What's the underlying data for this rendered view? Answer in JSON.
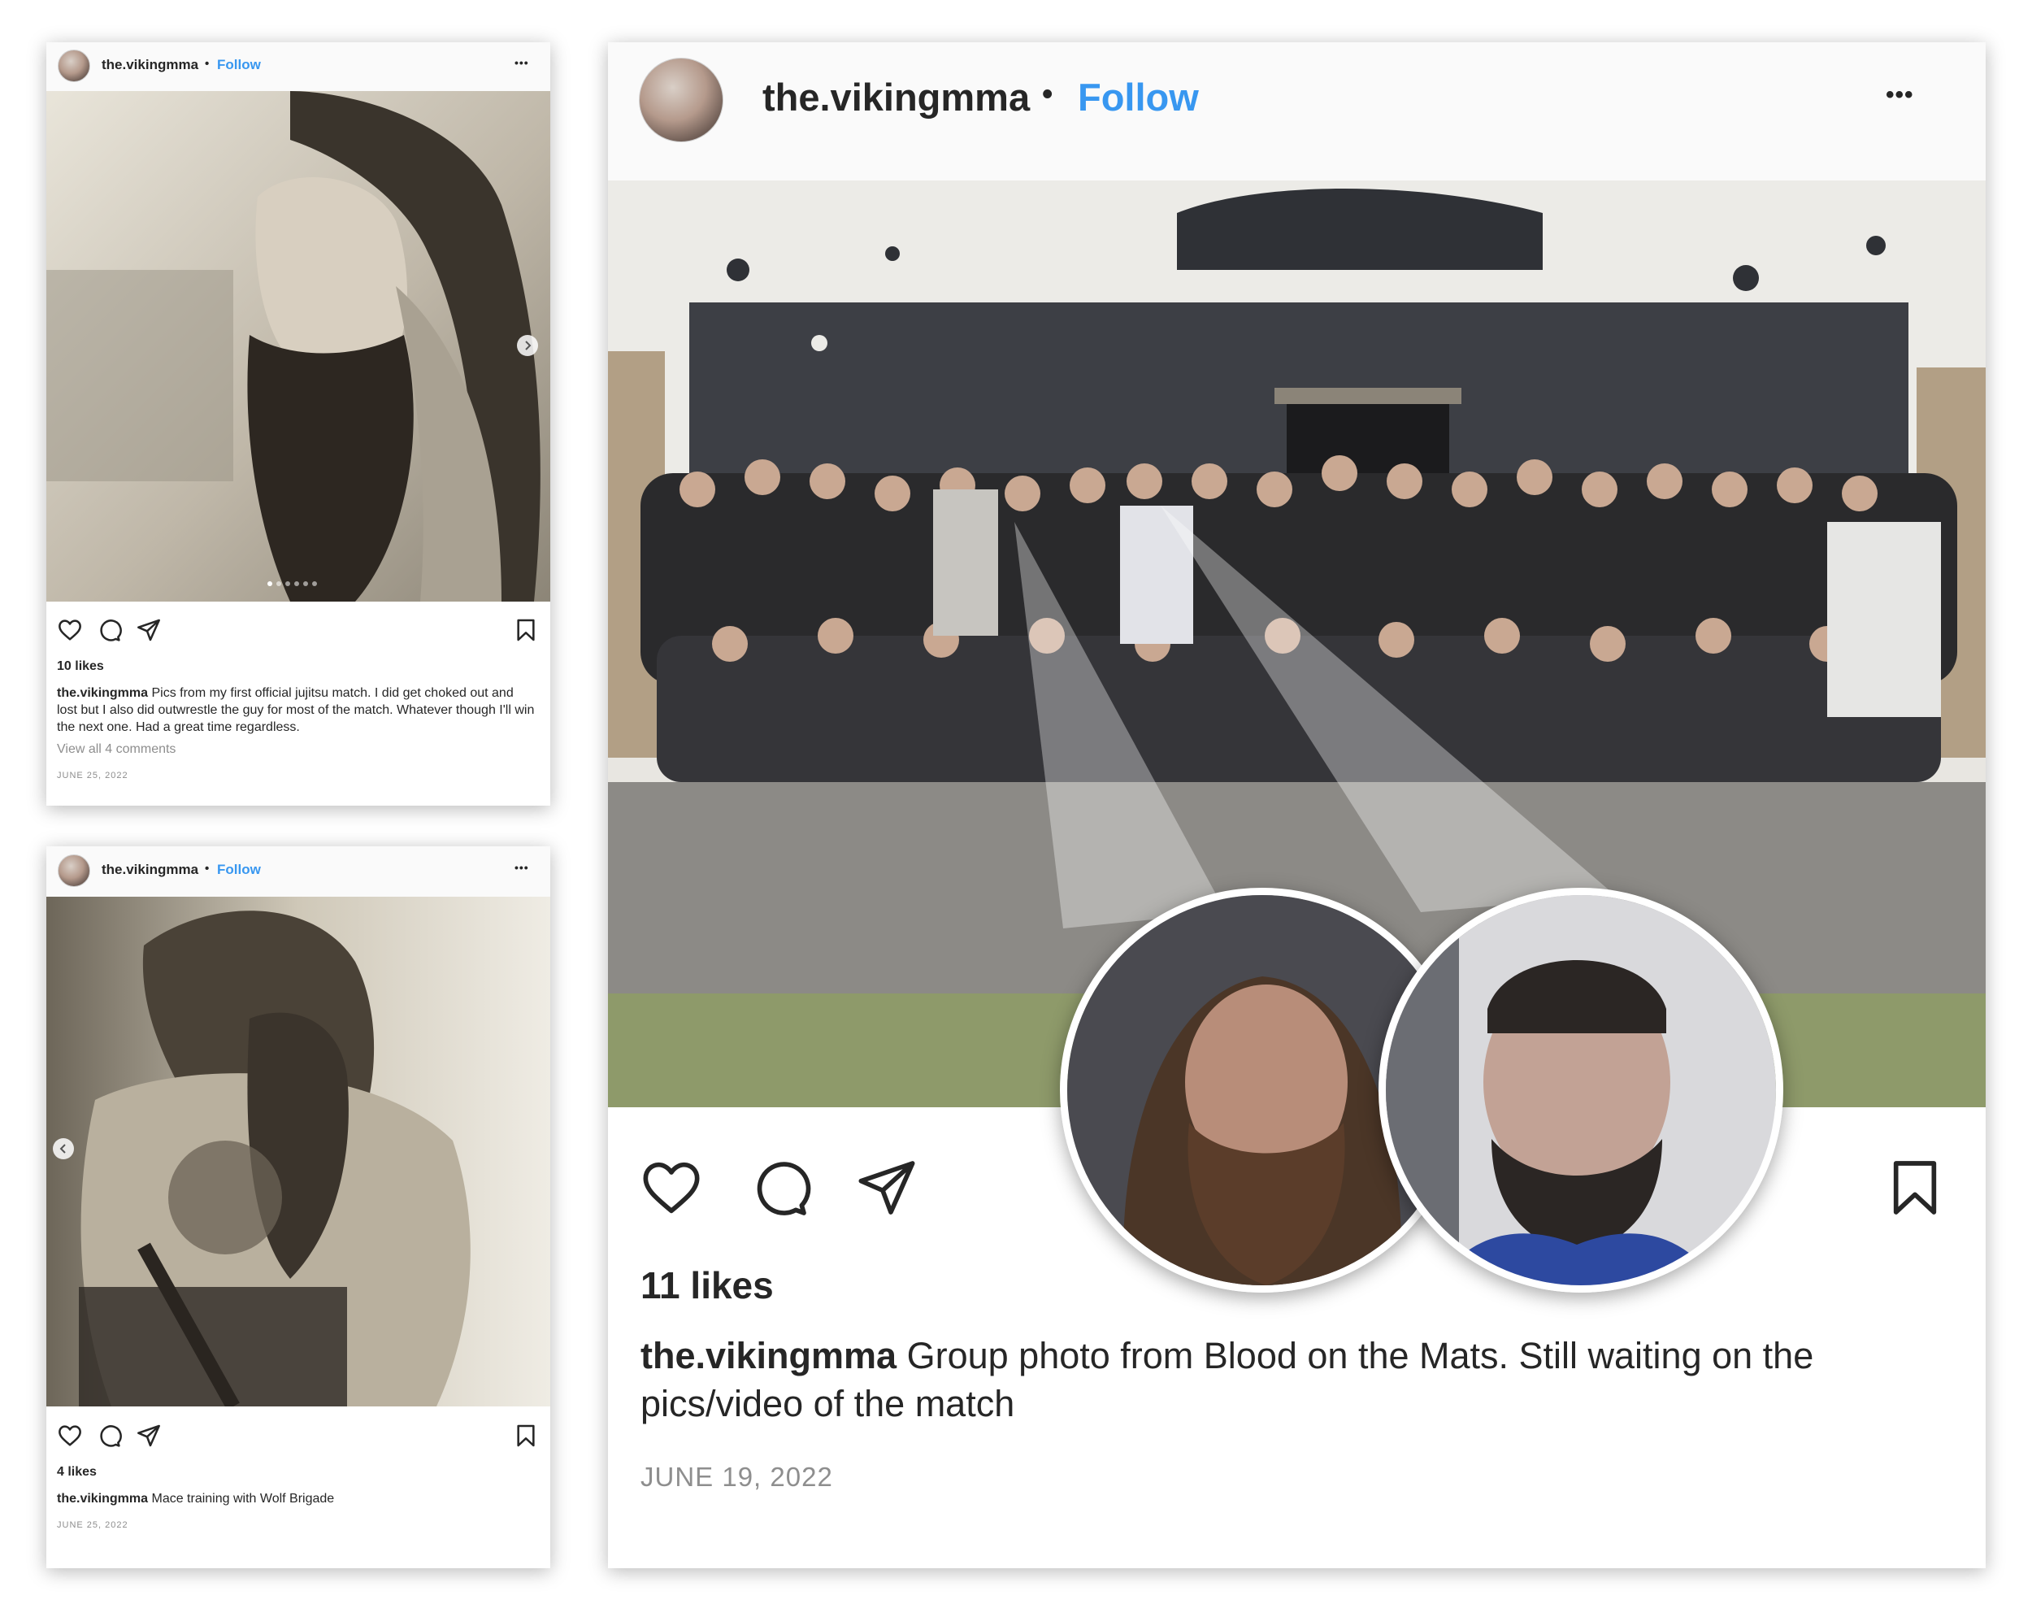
{
  "colors": {
    "follow": "#3897f0",
    "text": "#262626",
    "muted": "#8e8e8e",
    "header_bg": "#fafafa"
  },
  "post1": {
    "username": "the.vikingmma",
    "separator": "•",
    "follow": "Follow",
    "more": "•••",
    "likes": "10 likes",
    "caption_user": "the.vikingmma",
    "caption_text": "Pics from my first official jujitsu match. I did get choked out and lost but I also did outwrestle the guy for most of the match. Whatever though I'll win the next one. Had a great time regardless.",
    "comments": "View all 4 comments",
    "date": "JUNE 25, 2022",
    "carousel_pages": 6,
    "carousel_active": 1,
    "icons": [
      "heart-icon",
      "comment-icon",
      "share-icon",
      "bookmark-icon",
      "chevron-right-icon"
    ]
  },
  "post2": {
    "username": "the.vikingmma",
    "separator": "•",
    "follow": "Follow",
    "more": "•••",
    "likes": "4 likes",
    "caption_user": "the.vikingmma",
    "caption_text": "Mace training with Wolf Brigade",
    "date": "JUNE 25, 2022",
    "icons": [
      "heart-icon",
      "comment-icon",
      "share-icon",
      "bookmark-icon",
      "chevron-left-icon"
    ]
  },
  "post3": {
    "username": "the.vikingmma",
    "separator": "•",
    "follow": "Follow",
    "more": "•••",
    "likes": "11 likes",
    "caption_user": "the.vikingmma",
    "caption_text": "Group photo from Blood on the Mats. Still waiting on the pics/video of the match",
    "date": "JUNE 19, 2022",
    "icons": [
      "heart-icon",
      "comment-icon",
      "share-icon",
      "bookmark-icon"
    ]
  }
}
